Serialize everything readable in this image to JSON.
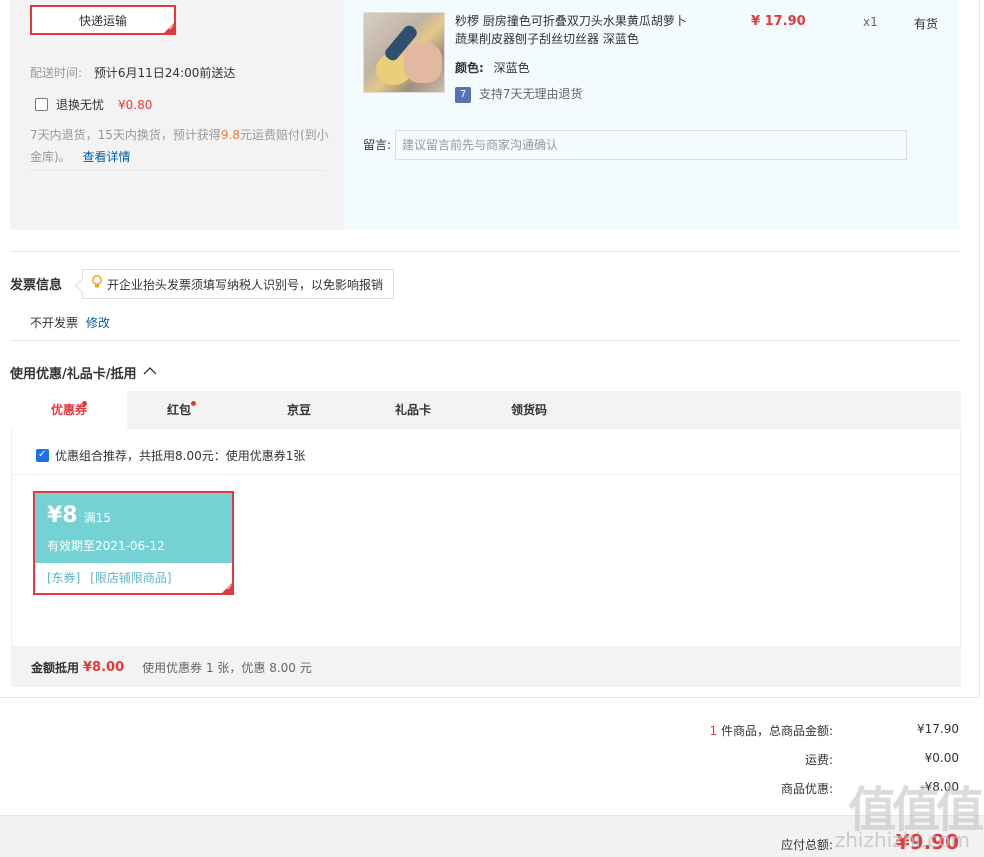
{
  "shipping": {
    "method_label": "快递运输",
    "delivery_time_label": "配送时间:",
    "delivery_time_value": "预计6月11日24:00前送达",
    "return_service_label": "退换无忧",
    "return_service_price": "¥0.80",
    "return_service_desc_1": "7天内退货，15天内换货，预计获得",
    "return_service_highlight": "9.8",
    "return_service_desc_2": "元运费赔付(到小",
    "return_service_desc_3": "金库)。",
    "details_link": "查看详情"
  },
  "product": {
    "title_line1": "粆椤 厨房撞色可折叠双刀头水果黄瓜胡萝卜",
    "title_line2": "蔬果削皮器刨子刮丝切丝器 深蓝色",
    "price": "¥ 17.90",
    "quantity": "x1",
    "stock": "有货",
    "color_label": "颜色:",
    "color_value": "深蓝色",
    "return_badge": "7",
    "return_policy": "支持7天无理由退货",
    "note_label": "留言:",
    "note_placeholder": "建议留言前先与商家沟通确认"
  },
  "invoice": {
    "title": "发票信息",
    "tip": "开企业抬头发票须填写纳税人识别号，以免影响报销",
    "value": "不开发票",
    "edit_link": "修改"
  },
  "discount": {
    "title": "使用优惠/礼品卡/抵用",
    "tabs": [
      {
        "label": "优惠券"
      },
      {
        "label": "红包"
      },
      {
        "label": "京豆"
      },
      {
        "label": "礼品卡"
      },
      {
        "label": "领货码"
      }
    ],
    "combo_recommend": "优惠组合推荐，共抵用8.00元：使用优惠券1张",
    "coupon": {
      "amount": "¥8",
      "condition": "满15",
      "expiry": "有效期至2021-06-12",
      "type_tag": "[东券]",
      "scope_tag": "[限店铺限商品]"
    },
    "summary_label": "金额抵用",
    "summary_amount": "¥8.00",
    "summary_desc": "使用优惠券 1 张，优惠 8.00 元"
  },
  "totals": {
    "item_count": "1",
    "item_count_suffix": " 件商品，总商品金额:",
    "goods_amount": "¥17.90",
    "shipping_label": "运费:",
    "shipping_amount": "¥0.00",
    "discount_label": "商品优惠:",
    "discount_amount": "-¥8.00",
    "payable_label": "应付总额:",
    "payable_amount": "¥9.90"
  },
  "watermark": {
    "logo": "值值值",
    "site": "zhizhizhi.com"
  },
  "colors": {
    "accent_red": "#e4393c",
    "link_blue": "#005ea7",
    "coupon_teal": "#74d2d4"
  }
}
